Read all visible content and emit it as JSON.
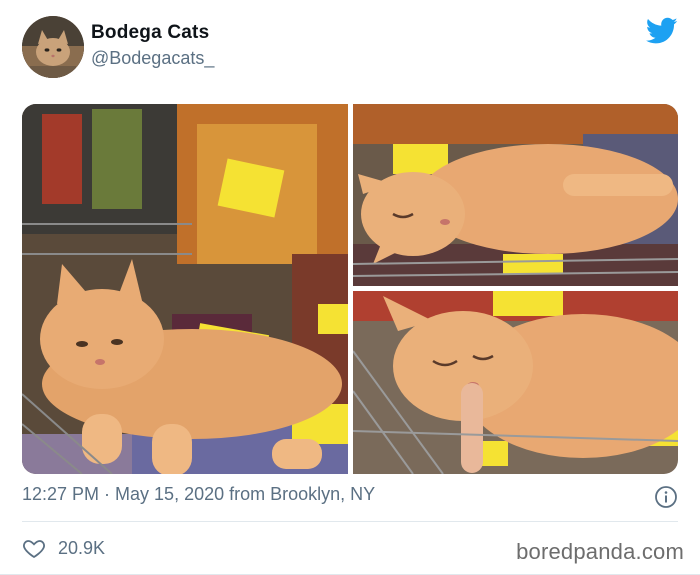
{
  "tweet": {
    "display_name": "Bodega Cats",
    "handle": "@Bodegacats_",
    "timestamp": "12:27 PM · May 15, 2020 from Brooklyn, NY",
    "likes": "20.9K"
  },
  "media": {
    "photos": [
      {
        "subject": "orange tabby cat lying on dried herb bags in a store basket"
      },
      {
        "subject": "orange tabby cat sleeping on bags in a wire basket"
      },
      {
        "subject": "orange tabby cat sleeping with a finger touching its nose"
      }
    ]
  },
  "icons": {
    "brand": "twitter-bird-icon",
    "info": "info-icon",
    "like": "heart-icon"
  },
  "colors": {
    "twitter_blue": "#1da1f2",
    "secondary_text": "#5b7083"
  },
  "watermark": "boredpanda.com"
}
